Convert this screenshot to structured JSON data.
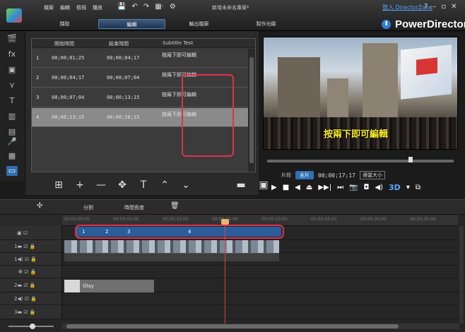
{
  "menu": [
    "檔案",
    "編輯",
    "檢視",
    "播放"
  ],
  "quick_tools": [
    "💾",
    "↶",
    "↷",
    "▦·",
    "⚙"
  ],
  "doc_title": "新增未命名專案*",
  "login_link": "登入 DirectorZone",
  "window_buttons": [
    "?",
    "–",
    "▫",
    "✕"
  ],
  "modes": [
    {
      "label": "擷取",
      "active": false
    },
    {
      "label": "編輯",
      "active": true
    },
    {
      "label": "輸出檔案",
      "active": false
    },
    {
      "label": "製作光碟",
      "active": false
    }
  ],
  "brand": {
    "icon": "⬆",
    "name": "PowerDirector"
  },
  "left_tools": [
    "🎬",
    "fx",
    "▣",
    "⋎",
    "T",
    "▥",
    "▤",
    "🎤",
    "▦",
    "▭"
  ],
  "subtitle_table": {
    "headers": [
      "開始時間",
      "結束時間",
      "Subtitle Text"
    ],
    "rows": [
      {
        "num": "1",
        "start": "00;00;01;25",
        "end": "00;00;04;17",
        "text": "按兩下即可編輯",
        "selected": false
      },
      {
        "num": "2",
        "start": "00;00;04;17",
        "end": "00;00;07;04",
        "text": "按兩下即可編輯",
        "selected": false
      },
      {
        "num": "3",
        "start": "00;00;07;04",
        "end": "00;00;13;15",
        "text": "按兩下即可編輯",
        "selected": false
      },
      {
        "num": "4",
        "start": "00;00;13;15",
        "end": "00;00;28;15",
        "text": "按兩下即可編輯",
        "selected": true
      }
    ]
  },
  "subtitle_tools": [
    "⊞",
    "+",
    "—",
    "✥",
    "T",
    "⌃",
    "⌄"
  ],
  "subtitle_tools_right": [
    "▬",
    "▣"
  ],
  "preview": {
    "subtitle_overlay": "按兩下即可編輯",
    "clip_label": "片段",
    "movie_tab": "全片",
    "timecode": "00;00;17;17",
    "dropdown": "適當大小",
    "controls": [
      "▶",
      "■",
      "◀",
      "⏏",
      "▶▶|",
      "⏭",
      "📷",
      "◘",
      "◀)"
    ],
    "three_d": "3D",
    "three_d_arrow": "▾",
    "extra": "⧉"
  },
  "midbar": {
    "icon": "✣",
    "split": "分割",
    "duration": "時間長度",
    "trash": "🗑"
  },
  "ruler_ticks": [
    "00:00:00:00",
    "00:00:05:00",
    "00:00:10:00",
    "00:00:15:00",
    "00:00:20:00",
    "00:00:25:00",
    "00:00:30:00",
    "00:00:35:00"
  ],
  "subtitle_markers": [
    "1",
    "2",
    "3",
    "4"
  ],
  "tracks": [
    {
      "label": "▣ ☑",
      "kind": "subtitle"
    },
    {
      "label": "1▬ ☑ 🔒",
      "kind": "video"
    },
    {
      "label": "1◀) ☑ 🔒",
      "kind": "audio"
    },
    {
      "label": "❁ ☑ 🔒",
      "kind": "fx"
    },
    {
      "label": "2▬ ☑ 🔒",
      "kind": "video"
    },
    {
      "label": "2◀) ☑ 🔒",
      "kind": "audio"
    },
    {
      "label": "3▬ ☑ 🔒",
      "kind": "video"
    }
  ],
  "title_clip_label": "Olay"
}
